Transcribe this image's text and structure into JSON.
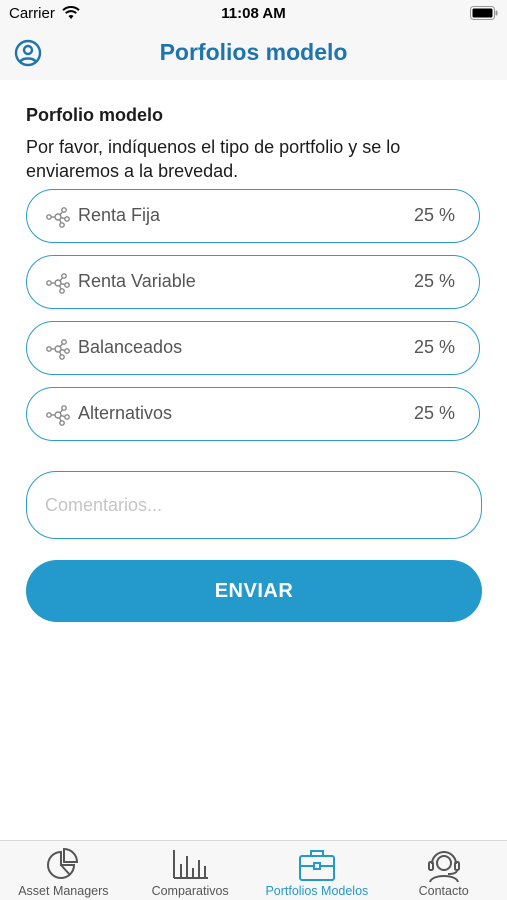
{
  "status_bar": {
    "carrier": "Carrier",
    "time": "11:08 AM"
  },
  "nav": {
    "title": "Porfolios modelo"
  },
  "form": {
    "heading": "Porfolio modelo",
    "description": "Por favor, indíquenos el tipo de portfolio y se lo enviaremos a la brevedad.",
    "rows": [
      {
        "label": "Renta Fija",
        "value": "25 %"
      },
      {
        "label": "Renta Variable",
        "value": "25 %"
      },
      {
        "label": "Balanceados",
        "value": "25 %"
      },
      {
        "label": "Alternativos",
        "value": "25 %"
      }
    ],
    "comment_placeholder": "Comentarios...",
    "submit_label": "ENVIAR"
  },
  "tabs": [
    {
      "label": "Asset Managers",
      "icon": "pie-chart-icon",
      "active": false
    },
    {
      "label": "Comparativos",
      "icon": "bar-chart-icon",
      "active": false
    },
    {
      "label": "Portfolios Modelos",
      "icon": "briefcase-icon",
      "active": true
    },
    {
      "label": "Contacto",
      "icon": "support-agent-icon",
      "active": false
    }
  ],
  "colors": {
    "accent": "#2499cb",
    "title": "#1e75ae",
    "border": "#2a9dcc"
  }
}
